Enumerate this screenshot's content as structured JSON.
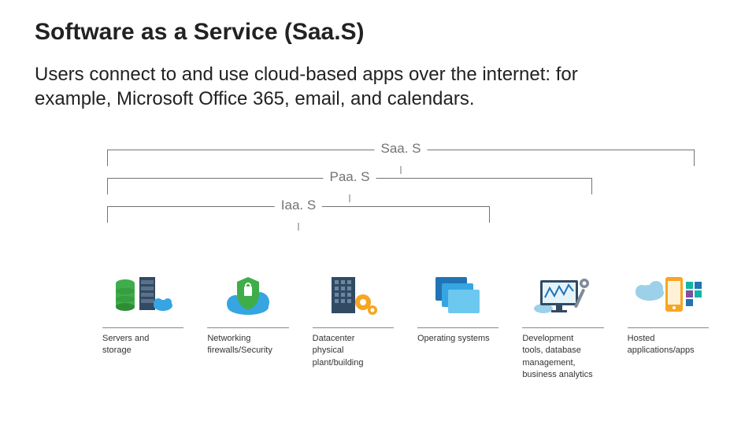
{
  "title": "Software as a Service (Saa.S)",
  "description": "Users connect to and use cloud-based apps over the internet: for example, Microsoft Office 365, email, and calendars.",
  "brackets": {
    "saas": "Saa. S",
    "paas": "Paa. S",
    "iaas": "Iaa. S"
  },
  "columns": [
    {
      "label": "Servers and\nstorage"
    },
    {
      "label": "Networking\nfirewalls/Security"
    },
    {
      "label": "Datacenter\nphysical\nplant/building"
    },
    {
      "label": "Operating systems"
    },
    {
      "label": "Development\ntools, database\nmanagement,\nbusiness analytics"
    },
    {
      "label": "Hosted applications/apps"
    }
  ]
}
